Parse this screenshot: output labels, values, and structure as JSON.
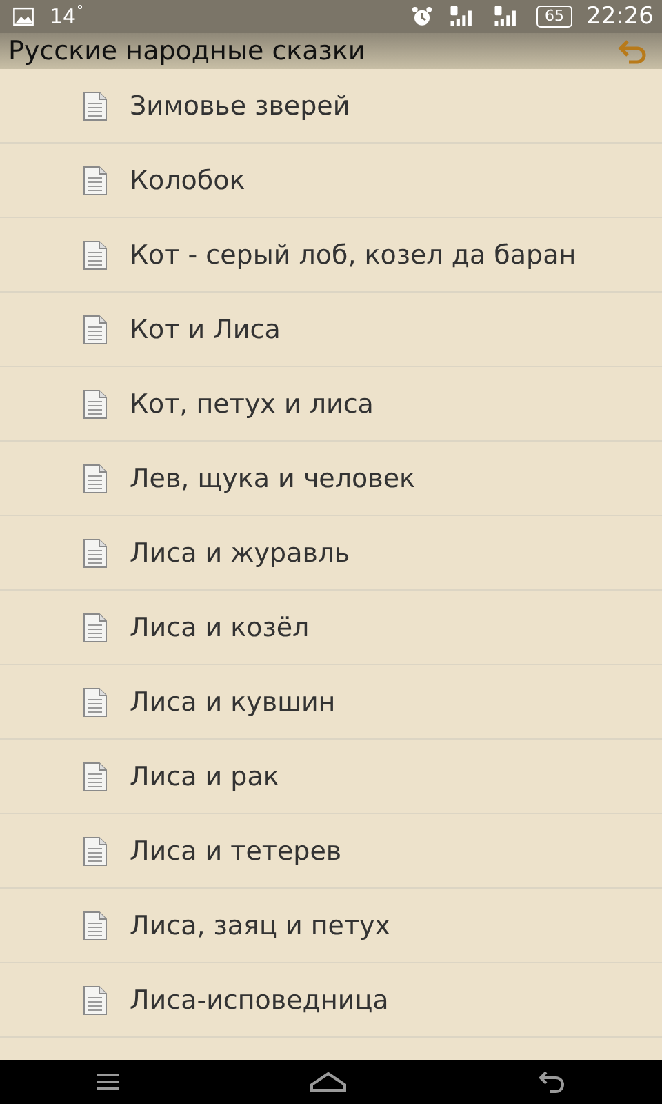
{
  "status_bar": {
    "temperature": "14",
    "battery": "65",
    "time": "22:26"
  },
  "title": "Русские народные сказки",
  "items": [
    {
      "title": "Зимовье зверей"
    },
    {
      "title": "Колобок"
    },
    {
      "title": "Кот - серый лоб, козел да баран"
    },
    {
      "title": "Кот и Лиса"
    },
    {
      "title": "Кот, петух и лиса"
    },
    {
      "title": "Лев, щука и человек"
    },
    {
      "title": "Лиса и журавль"
    },
    {
      "title": "Лиса и козёл"
    },
    {
      "title": "Лиса и кувшин"
    },
    {
      "title": "Лиса и рак"
    },
    {
      "title": "Лиса и тетерев"
    },
    {
      "title": "Лиса, заяц и петух"
    },
    {
      "title": "Лиса-исповедница"
    }
  ]
}
